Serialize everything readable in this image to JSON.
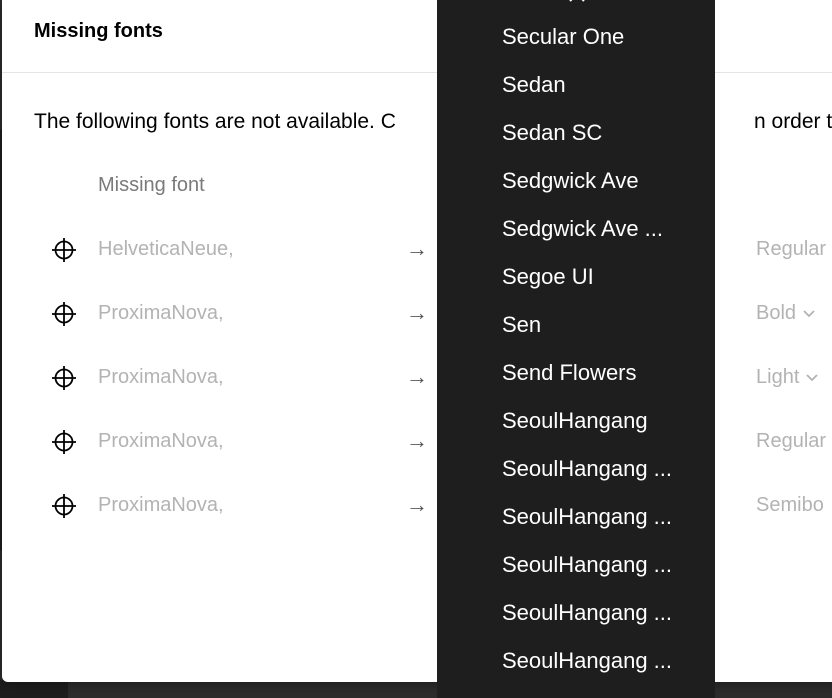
{
  "dialog": {
    "title": "Missing fonts",
    "description": "The following fonts are not available. C",
    "description_tail": "n order to ec",
    "column_header": "Missing font"
  },
  "rows": [
    {
      "missing": "HelveticaNeue,",
      "style": "Regular",
      "has_chevron": false
    },
    {
      "missing": "ProximaNova,",
      "style": "Bold",
      "has_chevron": true
    },
    {
      "missing": "ProximaNova,",
      "style": "Light",
      "has_chevron": true
    },
    {
      "missing": "ProximaNova,",
      "style": "Regular",
      "has_chevron": false
    },
    {
      "missing": "ProximaNova,",
      "style": "Semibo",
      "has_chevron": false
    }
  ],
  "arrow_glyph": "→",
  "dropdown": {
    "items": [
      "Secular One",
      "Sedan",
      "Sedan SC",
      "Sedgwick Ave",
      "Sedgwick Ave ...",
      "Segoe UI",
      "Sen",
      "Send Flowers",
      "SeoulHangang",
      "SeoulHangang ...",
      "SeoulHangang ...",
      "SeoulHangang ...",
      "SeoulHangang ...",
      "SeoulHangang ..."
    ]
  },
  "icons": {
    "locate": "crosshair-icon",
    "scroll_up": "caret-up-icon",
    "chevron": "chevron-down-icon"
  },
  "colors": {
    "dropdown_bg": "#1e1e1e",
    "muted_text": "#b3b3b3"
  }
}
